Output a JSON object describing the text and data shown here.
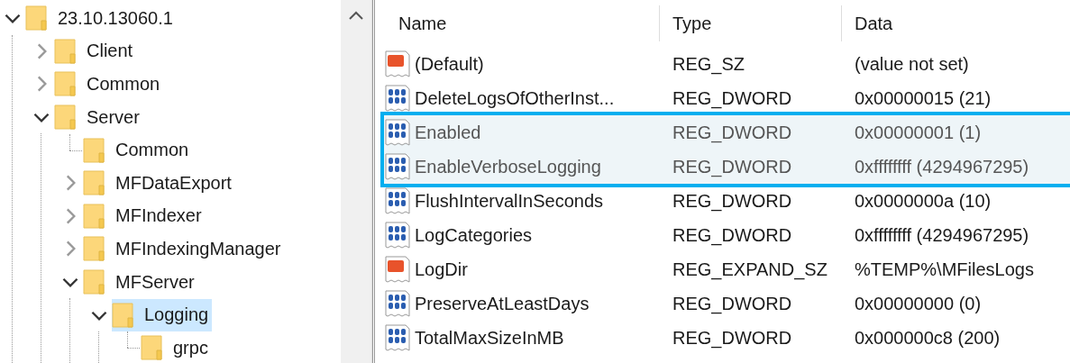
{
  "tree": {
    "label": "23.10.13060.1",
    "expanded": true,
    "selected": false,
    "children": [
      {
        "label": "Client",
        "expanded": false,
        "selected": false
      },
      {
        "label": "Common",
        "expanded": false,
        "selected": false
      },
      {
        "label": "Server",
        "expanded": true,
        "selected": false,
        "children": [
          {
            "label": "Common",
            "selected": false
          },
          {
            "label": "MFDataExport",
            "expanded": false,
            "selected": false
          },
          {
            "label": "MFIndexer",
            "expanded": false,
            "selected": false
          },
          {
            "label": "MFIndexingManager",
            "expanded": false,
            "selected": false
          },
          {
            "label": "MFServer",
            "expanded": true,
            "selected": false,
            "children": [
              {
                "label": "Logging",
                "expanded": true,
                "selected": true,
                "children": [
                  {
                    "label": "grpc",
                    "selected": false
                  }
                ]
              }
            ]
          }
        ]
      }
    ]
  },
  "table": {
    "columns": [
      "Name",
      "Type",
      "Data"
    ],
    "rows": [
      {
        "kind": "string",
        "name": "(Default)",
        "type": "REG_SZ",
        "data": "(value not set)",
        "highlighted": false
      },
      {
        "kind": "binary",
        "name": "DeleteLogsOfOtherInst...",
        "type": "REG_DWORD",
        "data": "0x00000015 (21)",
        "highlighted": false
      },
      {
        "kind": "binary",
        "name": "Enabled",
        "type": "REG_DWORD",
        "data": "0x00000001 (1)",
        "highlighted": true
      },
      {
        "kind": "binary",
        "name": "EnableVerboseLogging",
        "type": "REG_DWORD",
        "data": "0xffffffff (4294967295)",
        "highlighted": true
      },
      {
        "kind": "binary",
        "name": "FlushIntervalInSeconds",
        "type": "REG_DWORD",
        "data": "0x0000000a (10)",
        "highlighted": false
      },
      {
        "kind": "binary",
        "name": "LogCategories",
        "type": "REG_DWORD",
        "data": "0xffffffff (4294967295)",
        "highlighted": false
      },
      {
        "kind": "string",
        "name": "LogDir",
        "type": "REG_EXPAND_SZ",
        "data": "%TEMP%\\MFilesLogs",
        "highlighted": false
      },
      {
        "kind": "binary",
        "name": "PreserveAtLeastDays",
        "type": "REG_DWORD",
        "data": "0x00000000 (0)",
        "highlighted": false
      },
      {
        "kind": "binary",
        "name": "TotalMaxSizeInMB",
        "type": "REG_DWORD",
        "data": "0x000000c8 (200)",
        "highlighted": false
      }
    ]
  }
}
